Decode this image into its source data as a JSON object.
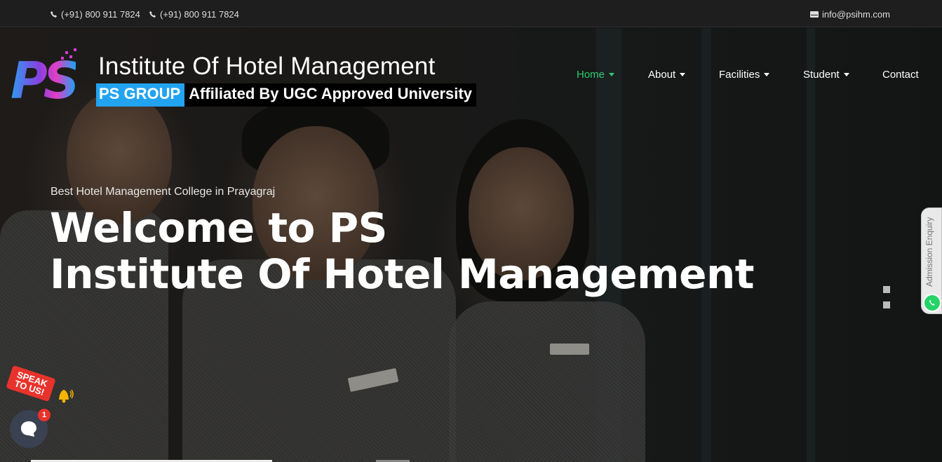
{
  "topbar": {
    "phone1": "(+91) 800 911 7824",
    "phone2": "(+91) 800 911 7824",
    "email": "info@psihm.com"
  },
  "logo": {
    "mark": "PS",
    "title": "Institute Of Hotel Management",
    "group": "PS GROUP",
    "affiliation": "Affiliated By UGC Approved University"
  },
  "nav": {
    "items": [
      {
        "label": "Home",
        "active": true,
        "dropdown": true
      },
      {
        "label": "About",
        "active": false,
        "dropdown": true
      },
      {
        "label": "Facilities",
        "active": false,
        "dropdown": true
      },
      {
        "label": "Student",
        "active": false,
        "dropdown": true
      },
      {
        "label": "Contact",
        "active": false,
        "dropdown": false
      }
    ]
  },
  "hero": {
    "eyebrow": "Best Hotel Management College in Prayagraj",
    "heading_line1": "Welcome to PS",
    "heading_line2": "Institute Of Hotel Management"
  },
  "admission": {
    "label": "Admission Enquiry"
  },
  "speak": {
    "label_line1": "SPEAK",
    "label_line2": "TO US!"
  },
  "chat": {
    "count": "1"
  },
  "colors": {
    "active_nav": "#2ecc71",
    "accent_blue": "#22a3f0",
    "speak_red": "#e8332c"
  },
  "icons": [
    "phone-icon",
    "mail-icon",
    "whatsapp-icon",
    "bell-icon",
    "chat-icon",
    "caret-down-icon"
  ]
}
